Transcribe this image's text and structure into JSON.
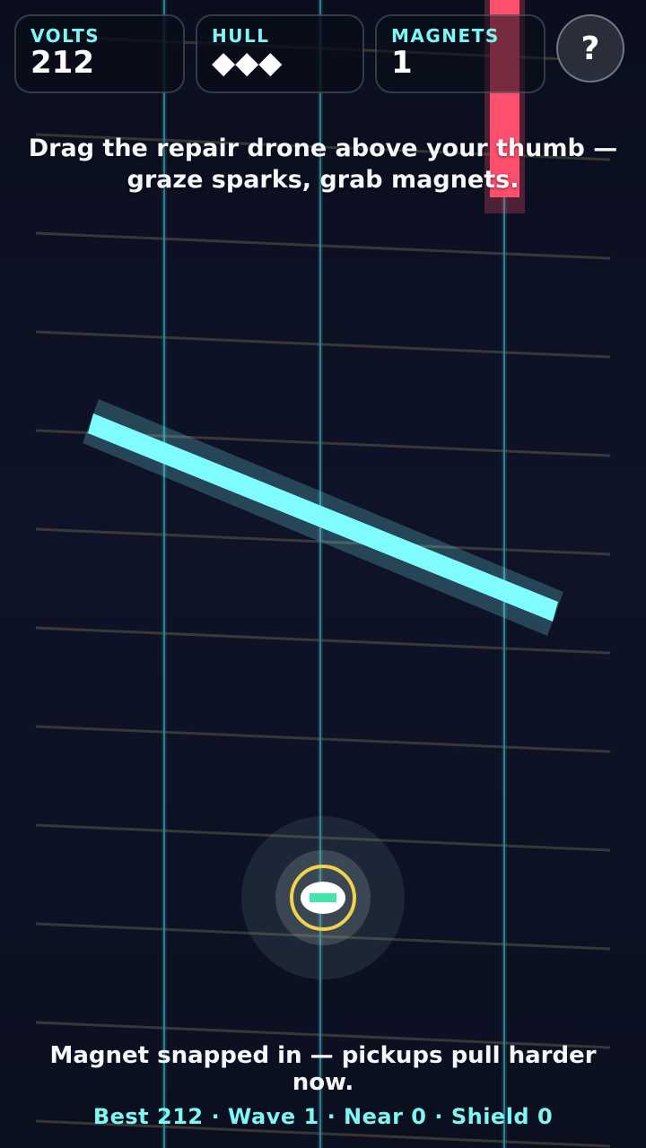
{
  "hud": {
    "volts": {
      "label": "VOLTS",
      "value": "212"
    },
    "hull": {
      "label": "HULL",
      "value": "◆◆◆"
    },
    "magnets": {
      "label": "MAGNETS",
      "value": "1"
    }
  },
  "help_button": {
    "label": "?"
  },
  "instruction": "Drag the repair drone above your thumb — graze sparks, grab magnets.",
  "status_message": "Magnet snapped in — pickups pull harder now.",
  "stats": {
    "best": "Best 212",
    "wave": "Wave 1",
    "near": "Near 0",
    "shield": "Shield 0",
    "separator": " · "
  },
  "colors": {
    "accent": "#7ff6f4",
    "hazard_beam": "#ff4f6e",
    "player_ring": "#f2d24a",
    "player_core": "#3fe6a8",
    "cyan_bar": "#7ffcff"
  },
  "icons": {
    "help": "question-mark-icon",
    "hull": "diamond-icon",
    "player": "repair-drone-icon"
  }
}
